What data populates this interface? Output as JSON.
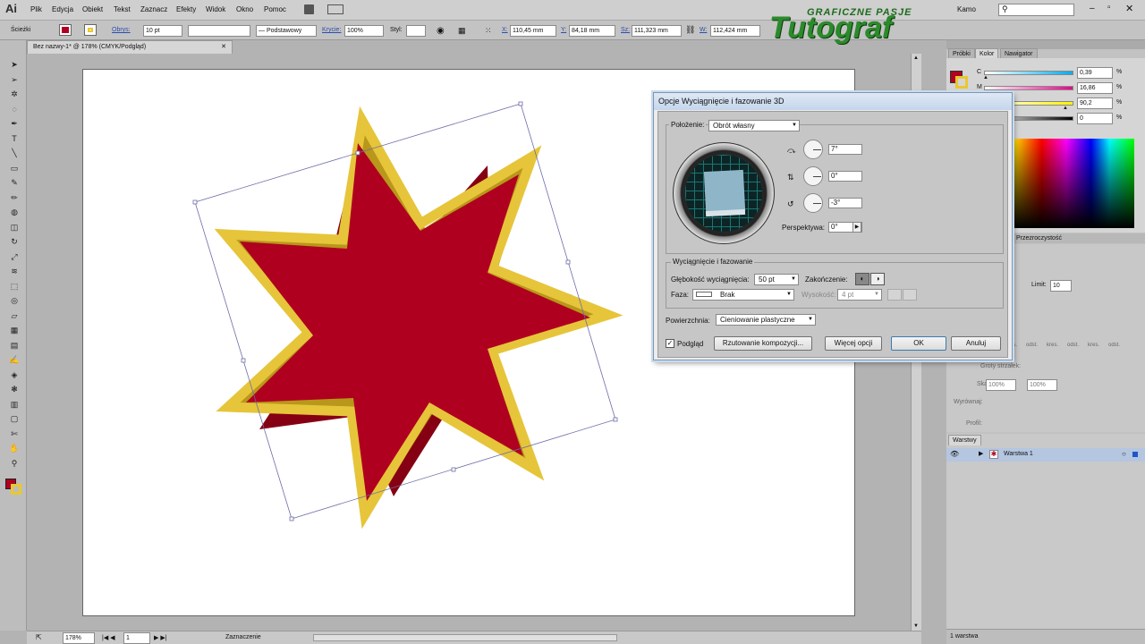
{
  "app": {
    "logo": "Ai",
    "menu": [
      "Plik",
      "Edycja",
      "Obiekt",
      "Tekst",
      "Zaznacz",
      "Efekty",
      "Widok",
      "Okno",
      "Pomoc"
    ],
    "user": "Kamo"
  },
  "watermark": {
    "line1": "GRAFICZNE PASJE",
    "line2": "Tutograf"
  },
  "control": {
    "path_label": "Ścieżki",
    "stroke_label": "Obrys:",
    "stroke_value": "10 pt",
    "profile": "Podstawowy",
    "opacity_label": "Krycie:",
    "opacity_value": "100%",
    "style_label": "Styl:",
    "x_label": "X:",
    "x_value": "110,45 mm",
    "y_label": "Y:",
    "y_value": "84,18 mm",
    "w_label": "Sz:",
    "w_value": "111,323 mm",
    "h_label": "W:",
    "h_value": "112,424 mm",
    "fill_color": "#b00020",
    "stroke_color": "#e8c830"
  },
  "document": {
    "tab_title": "Bez nazwy-1* @ 178% (CMYK/Podgląd)"
  },
  "tools": [
    "select-icon",
    "direct-select-icon",
    "magic-wand-icon",
    "lasso-icon",
    "pen-icon",
    "type-icon",
    "line-icon",
    "rectangle-icon",
    "brush-icon",
    "pencil-icon",
    "blob-brush-icon",
    "eraser-icon",
    "rotate-icon",
    "scale-icon",
    "width-icon",
    "free-transform-icon",
    "shape-builder-icon",
    "perspective-icon",
    "mesh-icon",
    "gradient-icon",
    "eyedropper-icon",
    "blend-icon",
    "symbol-sprayer-icon",
    "graph-icon",
    "artboard-icon",
    "slice-icon",
    "hand-icon",
    "zoom-icon"
  ],
  "status": {
    "zoom": "178%",
    "page": "1",
    "mode": "Zaznaczenie"
  },
  "panels": {
    "color_tabs": [
      "Próbki",
      "Kolor",
      "Nawigator"
    ],
    "cmyk": [
      {
        "label": "C",
        "value": "0,39",
        "pos": 0.01
      },
      {
        "label": "M",
        "value": "16,86",
        "pos": 0.17
      },
      {
        "label": "Y",
        "value": "90,2",
        "pos": 0.9
      },
      {
        "label": "K",
        "value": "0",
        "pos": 0
      }
    ],
    "percent": "%",
    "transparency_tab": "Przezroczystość",
    "stroke_limit_label": "Limit:",
    "stroke_limit": "10",
    "scale_label": "Skala:",
    "scale1": "100%",
    "scale2": "100%",
    "align_label": "Wyrównaj:",
    "profile_label": "Profil:",
    "arrows_label": "Groty strzałek:",
    "dash_labels": [
      "kres.",
      "odst.",
      "kres.",
      "odst.",
      "kres.",
      "odst."
    ]
  },
  "layers": {
    "tab": "Warstwy",
    "layer_name": "Warstwa 1",
    "footer": "1 warstwa"
  },
  "dialog": {
    "title": "Opcje Wyciągnięcie i fazowanie 3D",
    "position_label": "Położenie:",
    "position_value": "Obrót własny",
    "rot_x": "7°",
    "rot_y": "0°",
    "rot_z": "-3°",
    "perspective_label": "Perspektywa:",
    "perspective_value": "0°",
    "extrude_group": "Wyciągnięcie i fazowanie",
    "depth_label": "Głębokość wyciągnięcia:",
    "depth_value": "50 pt",
    "cap_label": "Zakończenie:",
    "bevel_label": "Faza:",
    "bevel_value": "Brak",
    "height_label": "Wysokość:",
    "height_value": "4 pt",
    "surface_label": "Powierzchnia:",
    "surface_value": "Cieniowanie plastyczne",
    "preview_label": "Podgląd",
    "preview_checked": true,
    "map_button": "Rzutowanie kompozycji...",
    "more_button": "Więcej opcji",
    "ok_button": "OK",
    "cancel_button": "Anuluj"
  }
}
